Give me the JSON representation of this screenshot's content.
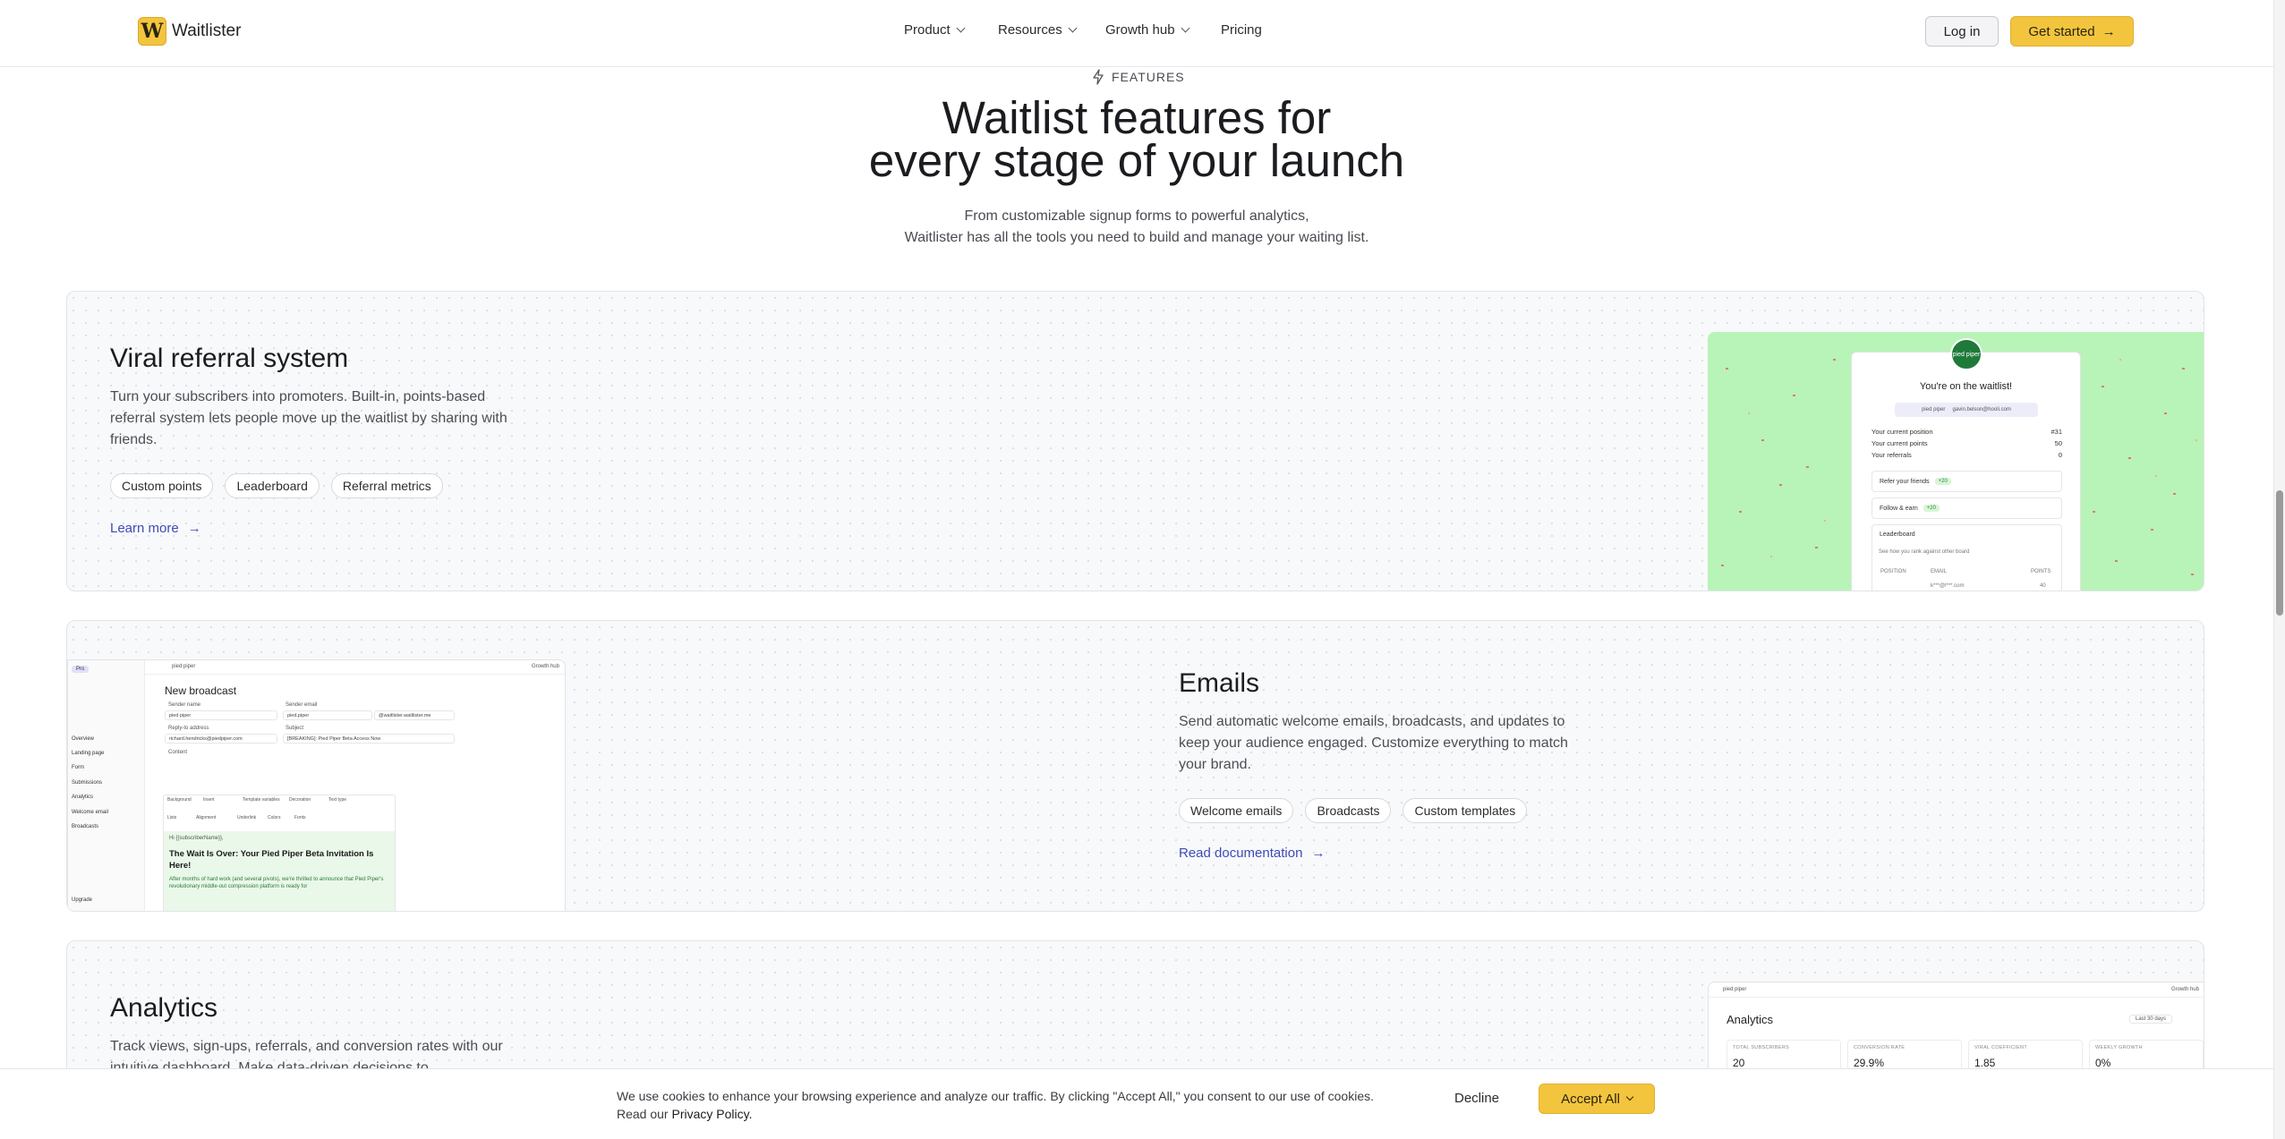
{
  "nav": {
    "logo_letter": "W",
    "brand": "Waitlister",
    "items": [
      {
        "label": "Product",
        "has_menu": true
      },
      {
        "label": "Resources",
        "has_menu": true
      },
      {
        "label": "Growth hub",
        "has_menu": true
      },
      {
        "label": "Pricing",
        "has_menu": false
      }
    ],
    "login": "Log in",
    "get_started": "Get started",
    "get_started_icon": "arrow-right-icon"
  },
  "hero": {
    "eyebrow": "FEATURES",
    "eyebrow_icon": "lightning-icon",
    "title_line1": "Waitlist features for",
    "title_line2": "every stage of your launch",
    "sub_line1": "From customizable signup forms to powerful analytics,",
    "sub_line2": "Waitlister has all the tools you need to build and manage your waiting list."
  },
  "viral": {
    "title": "Viral referral system",
    "description": "Turn your subscribers into promoters. Built-in, points-based referral system lets people move up the waitlist by sharing with friends.",
    "tags": [
      "Custom points",
      "Leaderboard",
      "Referral metrics"
    ],
    "link": "Learn more",
    "preview": {
      "avatar_text": "pied piper",
      "heading": "You're on the waitlist!",
      "pill_left": "pied piper",
      "pill_right": "gavin.belson@hooli.com",
      "position_label": "Your current position",
      "position_value": "#31",
      "points_label": "Your current points",
      "points_value": "50",
      "referrals_label": "Your referrals",
      "referrals_value": "0",
      "refer_label": "Refer your friends",
      "refer_badge": "+20",
      "follow_label": "Follow & earn",
      "follow_badge": "+20",
      "leaderboard_label": "Leaderboard",
      "leaderboard_sub": "See how you rank against other board",
      "col_position": "POSITION",
      "col_email": "EMAIL",
      "col_points": "POINTS",
      "row_email": "k***@l***.com",
      "row_points": "40"
    },
    "preview_bg": "#b8f3b8"
  },
  "emails": {
    "title": "Emails",
    "description": "Send automatic welcome emails, broadcasts, and updates to keep your audience engaged. Customize everything to match your brand.",
    "tags": [
      "Welcome emails",
      "Broadcasts",
      "Custom templates"
    ],
    "link": "Read documentation",
    "preview": {
      "plan": "Pro",
      "search": "pied piper",
      "growth": "Growth hub",
      "sidebar": [
        "Overview",
        "Landing page",
        "Form",
        "Submissions",
        "Analytics",
        "Welcome email",
        "Broadcasts"
      ],
      "upgrade": "Upgrade",
      "heading": "New broadcast",
      "sender_name_label": "Sender name",
      "sender_email_label": "Sender email",
      "sender_name_value": "pied piper",
      "sender_email_value": "pied.piper",
      "sender_domain": "@waitlister.waitlister.me",
      "reply_label": "Reply-to address",
      "subject_label": "Subject",
      "reply_value": "richard.hendricks@piedpiper.com",
      "subject_value": "[BREAKING]: Pied Piper Beta Access Now",
      "content_label": "Content",
      "toolbar_labels": [
        "Background",
        "Insert",
        "Template variables",
        "Decoration",
        "Text type"
      ],
      "toolbar_labels2": [
        "Lists",
        "Alignment",
        "Underlink",
        "Colors",
        "Fonts"
      ],
      "greeting": "Hi {{subscriberName}},",
      "email_heading": "The Wait Is Over: Your Pied Piper Beta Invitation Is Here!",
      "email_body": "After months of hard work (and several pivots), we're thrilled to announce that Pied Piper's revolutionary middle-out compression platform is ready for"
    }
  },
  "analytics": {
    "title": "Analytics",
    "description": "Track views, sign-ups, referrals, and conversion rates with our intuitive dashboard. Make data-driven decisions to",
    "preview": {
      "search": "pied piper",
      "growth": "Growth hub",
      "heading": "Analytics",
      "range": "Last 30 days",
      "stats": [
        {
          "label": "TOTAL SUBSCRIBERS",
          "value": "20"
        },
        {
          "label": "CONVERSION RATE",
          "value": "29.9%"
        },
        {
          "label": "VIRAL COEFFICIENT",
          "value": "1.85"
        },
        {
          "label": "WEEKLY GROWTH",
          "value": "0%"
        }
      ]
    }
  },
  "cookie": {
    "text": "We use cookies to enhance your browsing experience and analyze our traffic. By clicking \"Accept All,\" you consent to our use of cookies.",
    "read_our": "Read our",
    "privacy": "Privacy Policy.",
    "decline": "Decline",
    "accept": "Accept All"
  },
  "colors": {
    "brand_yellow": "#f3c53e",
    "link_blue": "#3e4bb5",
    "card_bg": "#f8f9fb"
  }
}
